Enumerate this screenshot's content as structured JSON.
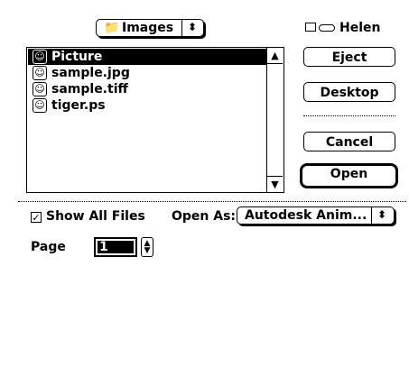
{
  "folder_popup": {
    "label": "Images",
    "icon": "folder-icon",
    "arrows": "⬍"
  },
  "volume": {
    "label": "Helen",
    "icon": "disk-icon"
  },
  "files": [
    {
      "name": "Picture",
      "selected": true
    },
    {
      "name": "sample.jpg",
      "selected": false
    },
    {
      "name": "sample.tiff",
      "selected": false
    },
    {
      "name": "tiger.ps",
      "selected": false
    }
  ],
  "buttons": {
    "eject": "Eject",
    "desktop": "Desktop",
    "cancel": "Cancel",
    "open": "Open"
  },
  "options": {
    "show_all_files": "Show All Files",
    "show_all_checked": true,
    "open_as_label": "Open As:",
    "open_as_value": "Autodesk Anim...",
    "page_label": "Page",
    "page_value": "1"
  }
}
